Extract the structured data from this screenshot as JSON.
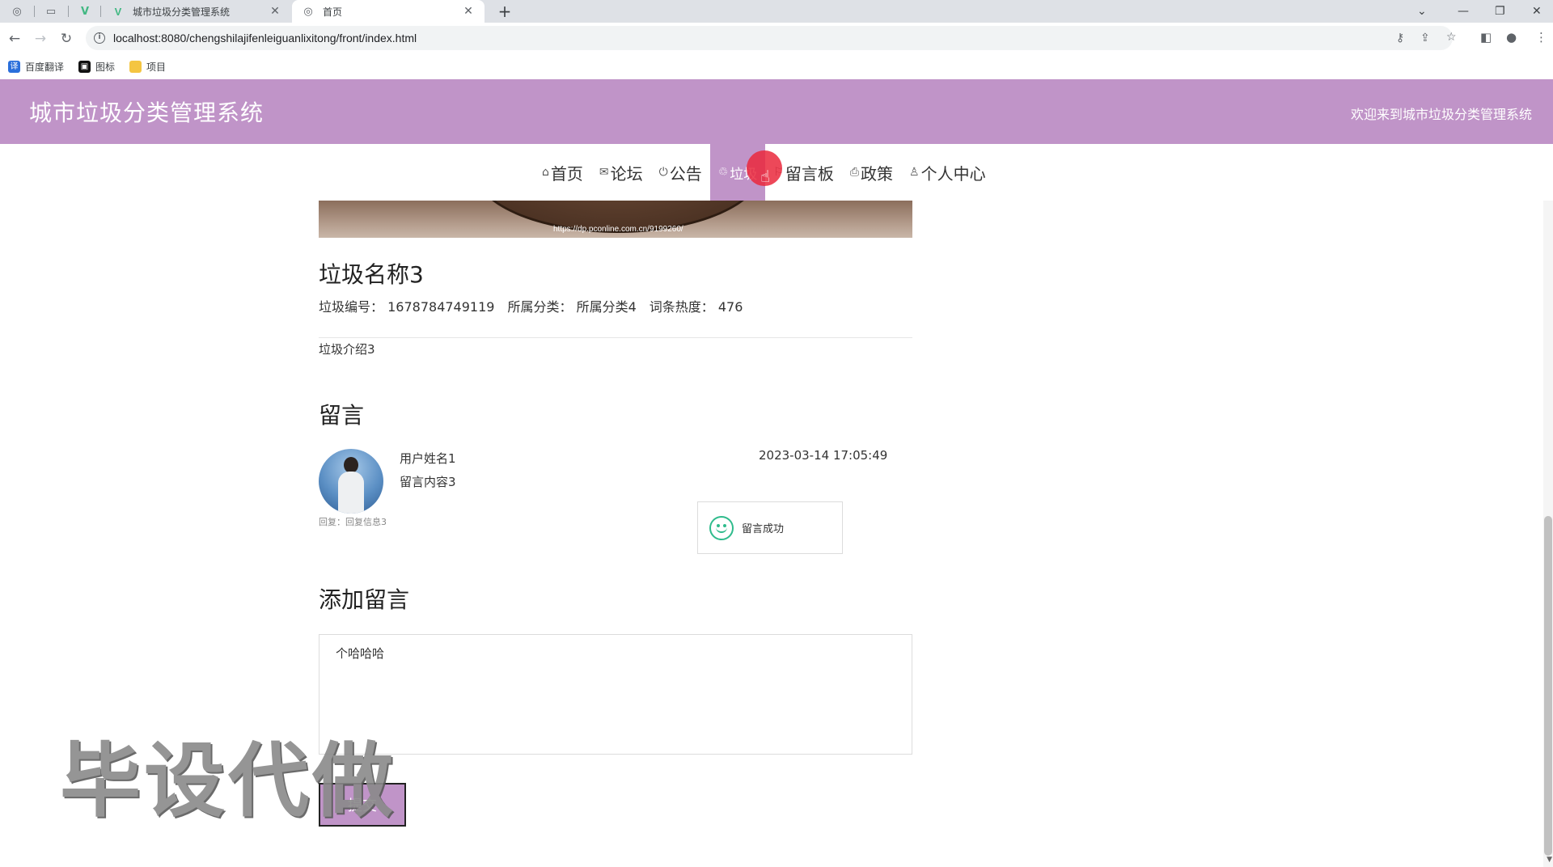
{
  "browser": {
    "tabs": [
      {
        "title": "城市垃圾分类管理系统",
        "icon": "vue-logo-icon"
      },
      {
        "title": "首页",
        "icon": "globe-icon",
        "active": true
      }
    ],
    "url": "localhost:8080/chengshilajifenleiguanlixitong/front/index.html",
    "bookmarks": [
      "百度翻译",
      "图标",
      "项目"
    ]
  },
  "header": {
    "title": "城市垃圾分类管理系统",
    "welcome": "欢迎来到城市垃圾分类管理系统",
    "background": "#c094c8"
  },
  "nav": {
    "items": [
      {
        "label": "首页",
        "icon": "home-icon"
      },
      {
        "label": "论坛",
        "icon": "mail-icon"
      },
      {
        "label": "公告",
        "icon": "power-icon"
      },
      {
        "label": "垃圾",
        "icon": "trash-icon",
        "active": true
      },
      {
        "label": "留言板",
        "icon": "flag-icon"
      },
      {
        "label": "政策",
        "icon": "printer-icon"
      },
      {
        "label": "个人中心",
        "icon": "user-icon"
      }
    ]
  },
  "detail": {
    "banner_url": "https://dp.pconline.com.cn/9199260/",
    "name": "垃圾名称3",
    "code_label": "垃圾编号：",
    "code": "1678784749119",
    "category_label": "所属分类：",
    "category": "所属分类4",
    "heat_label": "词条热度：",
    "heat": "476",
    "intro": "垃圾介绍3"
  },
  "comments": {
    "title": "留言",
    "items": [
      {
        "user": "用户姓名1",
        "content": "留言内容3",
        "time": "2023-03-14 17:05:49",
        "reply": "回复：回复信息3"
      }
    ]
  },
  "toast": {
    "message": "留言成功",
    "color": "#2fbb8c"
  },
  "add_comment": {
    "title": "添加留言",
    "value": "个哈哈哈",
    "submit_label": "提交"
  },
  "watermark": "毕设代做"
}
